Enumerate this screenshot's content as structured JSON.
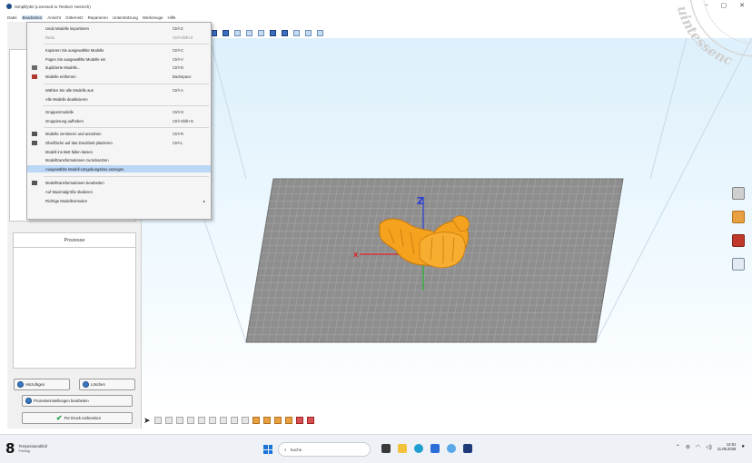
{
  "window": {
    "title": "Simplify3D (Licensed to Testkorr Heinrich)",
    "controls": [
      "–",
      "▢",
      "✕"
    ]
  },
  "menubar": [
    "Datei",
    "Bearbeiten",
    "Ansicht",
    "Gitternetz",
    "Reparieren",
    "Unterstützung",
    "Werkzeuge",
    "Hilfe"
  ],
  "edit_menu": {
    "items": [
      {
        "label": "Undo Modelle importieren",
        "shortcut": "Ctrl+Z",
        "disabled": false
      },
      {
        "label": "Redo",
        "shortcut": "Ctrl+Shift+Z",
        "disabled": true
      },
      {
        "label": "Kopieren Sie ausgewählte Modelle",
        "shortcut": "Ctrl+C",
        "disabled": false
      },
      {
        "label": "Fügen Sie ausgewählte Modelle ein",
        "shortcut": "Ctrl+V",
        "disabled": false
      },
      {
        "label": "duplizierte Modelle...",
        "shortcut": "Ctrl+D",
        "disabled": false
      },
      {
        "label": "Modelle entfernen",
        "shortcut": "Backspace",
        "disabled": false
      },
      {
        "label": "Wählen Sie alle Modelle aus",
        "shortcut": "Ctrl+A",
        "disabled": false
      },
      {
        "label": "Alle Modelle deaktivieren",
        "shortcut": "",
        "disabled": false
      },
      {
        "label": "Gruppenmodelle",
        "shortcut": "Ctrl+G",
        "disabled": false
      },
      {
        "label": "Gruppierung aufheben",
        "shortcut": "Ctrl+Shift+G",
        "disabled": false
      },
      {
        "label": "Modelle zentrieren und anordnen",
        "shortcut": "Ctrl+R",
        "disabled": false
      },
      {
        "label": "Oberfläche auf das Druckbett platzieren",
        "shortcut": "Ctrl+L",
        "disabled": false
      },
      {
        "label": "Modell ins Bett fallen lassen",
        "shortcut": "",
        "disabled": false
      },
      {
        "label": "Modelltransformationen zurücksetzen",
        "shortcut": "",
        "disabled": false
      },
      {
        "label": "Ausgewählte Modell-Umgebungsbox anzeigen",
        "shortcut": "",
        "disabled": false
      },
      {
        "label": "Modelltransformationen bearbeiten",
        "shortcut": "",
        "disabled": false
      },
      {
        "label": "Auf Maximalgröße skalieren",
        "shortcut": "",
        "disabled": false
      },
      {
        "label": "Richtige Modellnormalen",
        "shortcut": "",
        "disabled": false
      }
    ]
  },
  "left_panel": {
    "processes_title": "Prozesse",
    "buttons": {
      "add": "Hinzufügen",
      "delete": "Löschen",
      "edit_process": "Prozesseinstellungen bearbeiten",
      "prepare_print": "Für Druck vorbereiten"
    }
  },
  "taskbar": {
    "weather_num": "8",
    "weather_line1": "Temperaturabfall",
    "weather_line2": "Freitag",
    "search": "Suche",
    "time": "14:51",
    "date": "11.08.2025"
  },
  "watermark": "uintessenc",
  "colors": {
    "accent": "#1a73d9",
    "model_orange": "#f5a21f",
    "bed_grey": "#8c8c8c",
    "highlight": "#bcd7f5"
  }
}
